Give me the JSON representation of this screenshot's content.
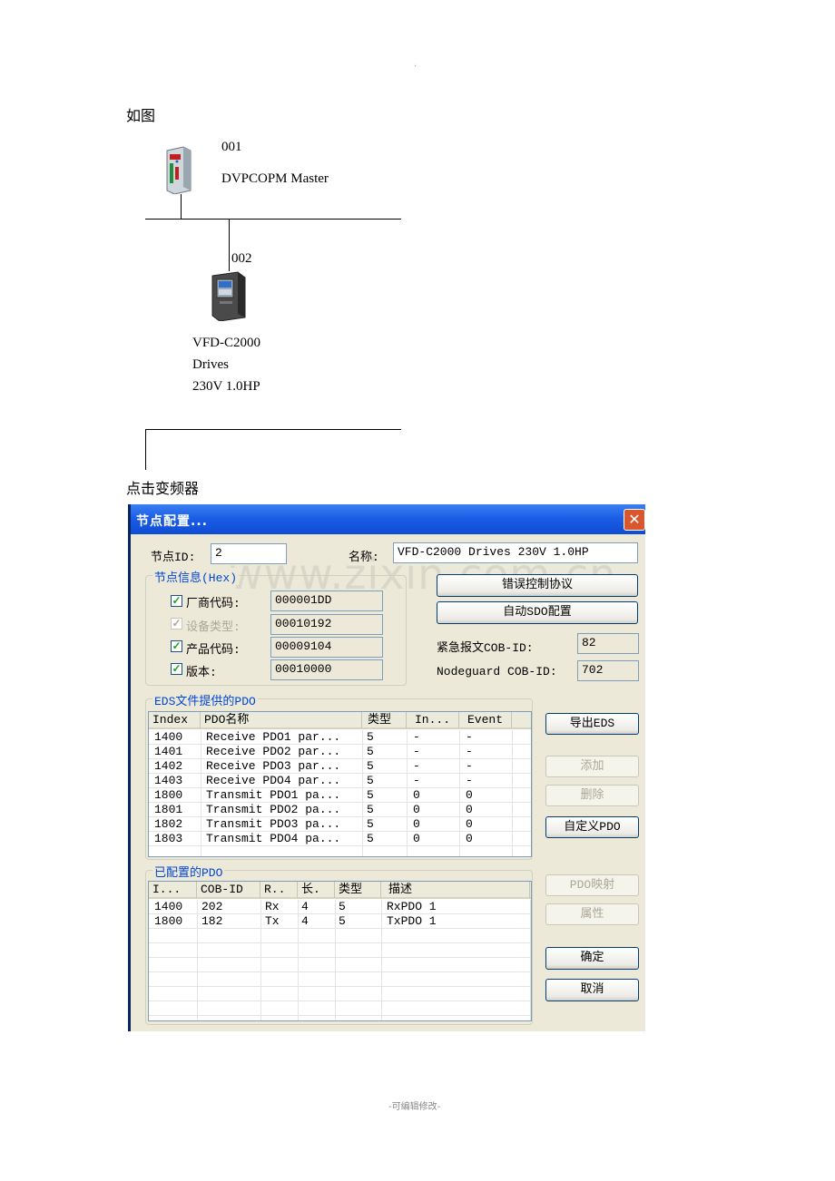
{
  "top_dot": "·",
  "intro_text": "如图",
  "network": {
    "master": {
      "address": "001",
      "name": "DVPCOPM Master"
    },
    "slave": {
      "address": "002",
      "name_lines": [
        "VFD-C2000",
        "Drives",
        "230V 1.0HP"
      ]
    }
  },
  "click_text": "点击变频器",
  "dialog": {
    "title": "节点配置...",
    "close_glyph": "✕",
    "node_id_label": "节点ID:",
    "node_id_value": "2",
    "name_label": "名称:",
    "name_value": "VFD-C2000 Drives 230V 1.0HP",
    "node_info": {
      "title": "节点信息(Hex)",
      "rows": [
        {
          "label": "厂商代码:",
          "value": "000001DD",
          "checked": true,
          "disabled": false
        },
        {
          "label": "设备类型:",
          "value": "00010192",
          "checked": true,
          "disabled": true
        },
        {
          "label": "产品代码:",
          "value": "00009104",
          "checked": true,
          "disabled": false
        },
        {
          "label": "版本:",
          "value": "00010000",
          "checked": true,
          "disabled": false
        }
      ]
    },
    "buttons_right": {
      "error_control": "错误控制协议",
      "auto_sdo": "自动SDO配置",
      "export_eds": "导出EDS",
      "add": "添加",
      "delete": "删除",
      "custom_pdo": "自定义PDO",
      "pdo_mapping": "PDO映射",
      "properties": "属性",
      "ok": "确定",
      "cancel": "取消"
    },
    "emergency_label": "紧急报文COB-ID:",
    "emergency_value": "82",
    "nodeguard_label": "Nodeguard COB-ID:",
    "nodeguard_value": "702",
    "eds_pdo": {
      "title": "EDS文件提供的PDO",
      "columns": [
        "Index",
        "PDO名称",
        "类型",
        "In...",
        "Event"
      ],
      "rows": [
        [
          "1400",
          "Receive PDO1 par...",
          "5",
          "-",
          "-"
        ],
        [
          "1401",
          "Receive PDO2 par...",
          "5",
          "-",
          "-"
        ],
        [
          "1402",
          "Receive PDO3 par...",
          "5",
          "-",
          "-"
        ],
        [
          "1403",
          "Receive PDO4 par...",
          "5",
          "-",
          "-"
        ],
        [
          "1800",
          "Transmit PDO1 pa...",
          "5",
          "0",
          "0"
        ],
        [
          "1801",
          "Transmit PDO2 pa...",
          "5",
          "0",
          "0"
        ],
        [
          "1802",
          "Transmit PDO3 pa...",
          "5",
          "0",
          "0"
        ],
        [
          "1803",
          "Transmit PDO4 pa...",
          "5",
          "0",
          "0"
        ]
      ]
    },
    "configured_pdo": {
      "title": "已配置的PDO",
      "columns": [
        "I...",
        "COB-ID",
        "R..",
        "长.",
        "类型",
        "描述"
      ],
      "rows": [
        [
          "1400",
          "202",
          "Rx",
          "4",
          "5",
          "RxPDO 1"
        ],
        [
          "1800",
          "182",
          "Tx",
          "4",
          "5",
          "TxPDO 1"
        ]
      ]
    }
  },
  "watermark": "www.zixin.com.cn",
  "footer": "-可编辑修改-",
  "colors": {
    "title_bar": "#1c5ee6",
    "group_title": "#0046d5",
    "dialog_bg": "#ece9d8",
    "check": "#21a121"
  }
}
